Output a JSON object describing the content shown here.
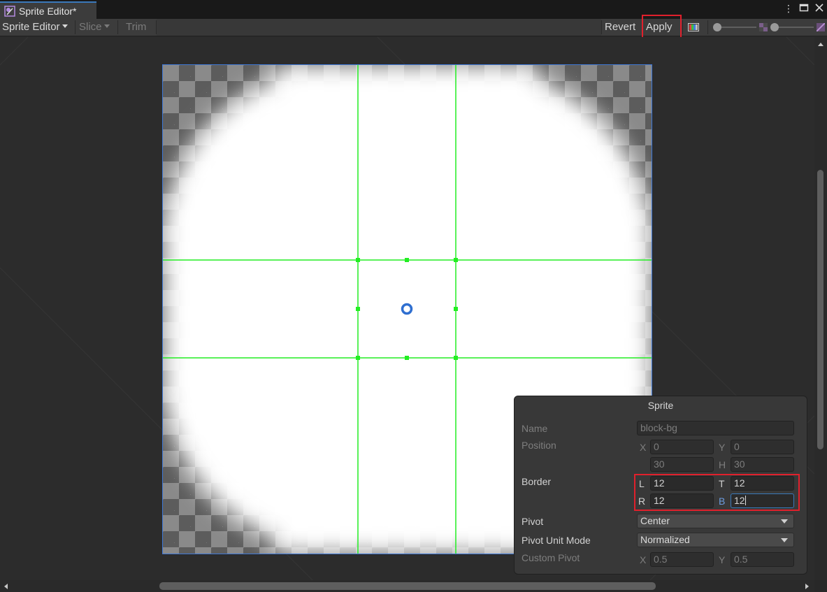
{
  "window": {
    "tab_title": "Sprite Editor*",
    "tab_icon": "sprite-editor-icon",
    "buttons": [
      "more-options-icon",
      "maximize-icon",
      "close-icon"
    ]
  },
  "toolbar": {
    "mode_label": "Sprite Editor",
    "slice_label": "Slice",
    "trim_label": "Trim",
    "revert_label": "Revert",
    "apply_label": "Apply"
  },
  "sprite_panel": {
    "title": "Sprite",
    "name_label": "Name",
    "name_value": "block-bg",
    "position_label": "Position",
    "x_axis": "X",
    "x_value": "0",
    "y_axis": "Y",
    "y_value": "0",
    "w_value": "30",
    "h_axis": "H",
    "h_value": "30",
    "border_label": "Border",
    "l_axis": "L",
    "l_value": "12",
    "t_axis": "T",
    "t_value": "12",
    "r_axis": "R",
    "r_value": "12",
    "b_axis": "B",
    "b_value": "12",
    "pivot_label": "Pivot",
    "pivot_value": "Center",
    "pivot_unit_label": "Pivot Unit Mode",
    "pivot_unit_value": "Normalized",
    "custom_pivot_label": "Custom Pivot",
    "cp_x_axis": "X",
    "cp_x_value": "0.5",
    "cp_y_axis": "Y",
    "cp_y_value": "0.5"
  },
  "colors": {
    "guide": "#22ee22",
    "sprite_outline": "#3e78d6",
    "highlight": "#e0202c"
  }
}
